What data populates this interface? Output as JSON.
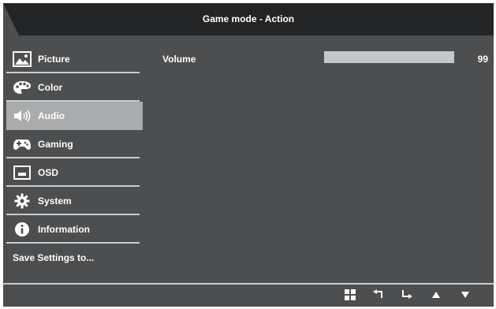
{
  "title": "Game mode - Action",
  "sidebar": {
    "items": [
      {
        "label": "Picture",
        "icon": "picture-icon",
        "selected": false
      },
      {
        "label": "Color",
        "icon": "palette-icon",
        "selected": false
      },
      {
        "label": "Audio",
        "icon": "speaker-icon",
        "selected": true
      },
      {
        "label": "Gaming",
        "icon": "gamepad-icon",
        "selected": false
      },
      {
        "label": "OSD",
        "icon": "osd-icon",
        "selected": false
      },
      {
        "label": "System",
        "icon": "gear-icon",
        "selected": false
      },
      {
        "label": "Information",
        "icon": "info-icon",
        "selected": false
      },
      {
        "label": "Save Settings to...",
        "icon": null,
        "selected": false
      }
    ]
  },
  "content": {
    "volume": {
      "label": "Volume",
      "value": "99",
      "level_percent": 99
    }
  },
  "footer": {
    "icons": [
      "grid-icon",
      "back-icon",
      "enter-icon",
      "up-arrow-icon",
      "down-arrow-icon"
    ]
  },
  "colors": {
    "panel_bg": "#4c4e50",
    "title_bg": "#232425",
    "selected_bg": "#a9abad",
    "separator": "#c9cbcd",
    "text": "#ffffff"
  }
}
